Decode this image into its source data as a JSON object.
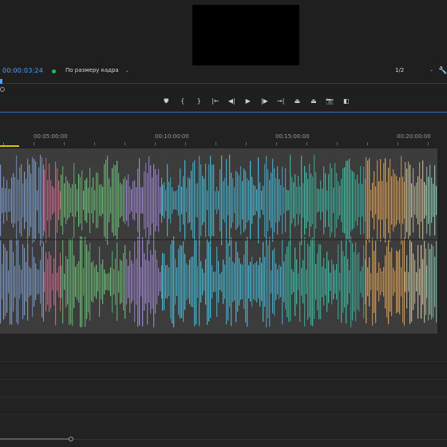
{
  "program_monitor": {
    "timecode": "00:00:03:24",
    "fit_label": "По размеру кадра",
    "resolution": "1/2",
    "status_color": "#1fbf4a"
  },
  "transport": [
    {
      "name": "add-marker-button",
      "icon": "marker-icon",
      "glyph": "⛊"
    },
    {
      "name": "mark-in-button",
      "icon": "mark-in-icon",
      "glyph": "{"
    },
    {
      "name": "mark-out-button",
      "icon": "mark-out-icon",
      "glyph": "}"
    },
    {
      "name": "go-to-in-button",
      "icon": "go-to-in-icon",
      "glyph": "|←"
    },
    {
      "name": "step-back-button",
      "icon": "step-back-icon",
      "glyph": "◀|"
    },
    {
      "name": "play-button",
      "icon": "play-icon",
      "glyph": "▶"
    },
    {
      "name": "step-forward-button",
      "icon": "step-forward-icon",
      "glyph": "|▶"
    },
    {
      "name": "go-to-out-button",
      "icon": "go-to-out-icon",
      "glyph": "→|"
    },
    {
      "name": "lift-button",
      "icon": "lift-icon",
      "glyph": "⏏"
    },
    {
      "name": "extract-button",
      "icon": "extract-icon",
      "glyph": "⏏"
    },
    {
      "name": "export-frame-button",
      "icon": "camera-icon",
      "glyph": "📷"
    },
    {
      "name": "compare-button",
      "icon": "compare-icon",
      "glyph": "◧"
    }
  ],
  "ruler": {
    "ticks": [
      {
        "label": "00:05:00:00",
        "pos": 0.107
      },
      {
        "label": "00:10:00:00",
        "pos": 0.378
      },
      {
        "label": "00:15:00:00",
        "pos": 0.649
      },
      {
        "label": "00:20:00:00",
        "pos": 0.92
      }
    ]
  },
  "clips": [
    {
      "color": "#7f9fd0",
      "start": 0.0,
      "end": 0.1
    },
    {
      "color": "#d06b8f",
      "start": 0.1,
      "end": 0.138
    },
    {
      "color": "#6fc47a",
      "start": 0.138,
      "end": 0.288
    },
    {
      "color": "#a48ad8",
      "start": 0.288,
      "end": 0.37
    },
    {
      "color": "#46bcd8",
      "start": 0.37,
      "end": 0.655
    },
    {
      "color": "#3fbfa9",
      "start": 0.655,
      "end": 0.835
    },
    {
      "color": "#e2a55a",
      "start": 0.835,
      "end": 0.925
    },
    {
      "color": "#cfc3a0",
      "start": 0.925,
      "end": 0.975
    },
    {
      "color": "#8cc8b0",
      "start": 0.975,
      "end": 1.0
    }
  ]
}
